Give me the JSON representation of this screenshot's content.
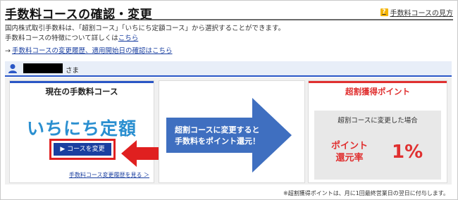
{
  "header": {
    "title": "手数料コースの確認・変更",
    "help_icon": "question-icon",
    "help_link": "手数料コースの見方"
  },
  "intro": {
    "line1": "国内株式取引手数料は、「超割コース」「いちにち定額コース」から選択することができます。",
    "line2_text": "手数料コースの特徴について詳しくは",
    "line2_link": "こちら"
  },
  "history": {
    "arrow": "→",
    "link": "手数料コースの変更履歴、適用開始日の確認はこちら"
  },
  "user_bar": {
    "icon": "person-icon",
    "suffix": "さま"
  },
  "current_plan": {
    "heading": "現在の手数料コース",
    "plan_name": "いちにち定額",
    "change_button": "▶ コースを変更",
    "history_link": "手数料コース変更履歴を見る ＞"
  },
  "promo": {
    "line1": "超割コースに変更すると",
    "line2": "手数料をポイント還元！"
  },
  "points": {
    "heading": "超割獲得ポイント",
    "caption": "超割コースに変更した場合",
    "rate_label_1": "ポイント",
    "rate_label_2": "還元率",
    "rate_value": "1%"
  },
  "footer_note": "※超割獲得ポイントは、月に1回最終営業日の翌日に付与します。",
  "colors": {
    "brand_blue": "#1a3fa0",
    "accent_red": "#e03030",
    "plan_blue": "#2a8fd0"
  }
}
